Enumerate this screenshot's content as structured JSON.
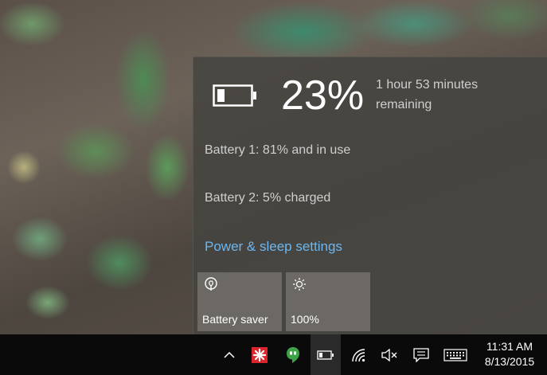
{
  "flyout": {
    "percent": "23%",
    "remaining": "1 hour 53 minutes remaining",
    "battery1": "Battery 1: 81% and in use",
    "battery2": "Battery 2: 5% charged",
    "settings_link": "Power & sleep settings",
    "charge_level": 0.23,
    "tiles": [
      {
        "label": "Battery saver",
        "icon": "battery-saver-icon"
      },
      {
        "label": "100%",
        "icon": "brightness-icon"
      }
    ]
  },
  "taskbar": {
    "time": "11:31 AM",
    "date": "8/13/2015",
    "icons": [
      "chevron-up-icon",
      "red-app-icon",
      "hangouts-icon",
      "battery-icon",
      "wifi-icon",
      "speaker-muted-icon",
      "action-center-icon",
      "keyboard-icon"
    ]
  },
  "colors": {
    "link": "#6cb7f0",
    "flyout_bg": "#464440",
    "taskbar_bg": "#0a0a0a"
  }
}
